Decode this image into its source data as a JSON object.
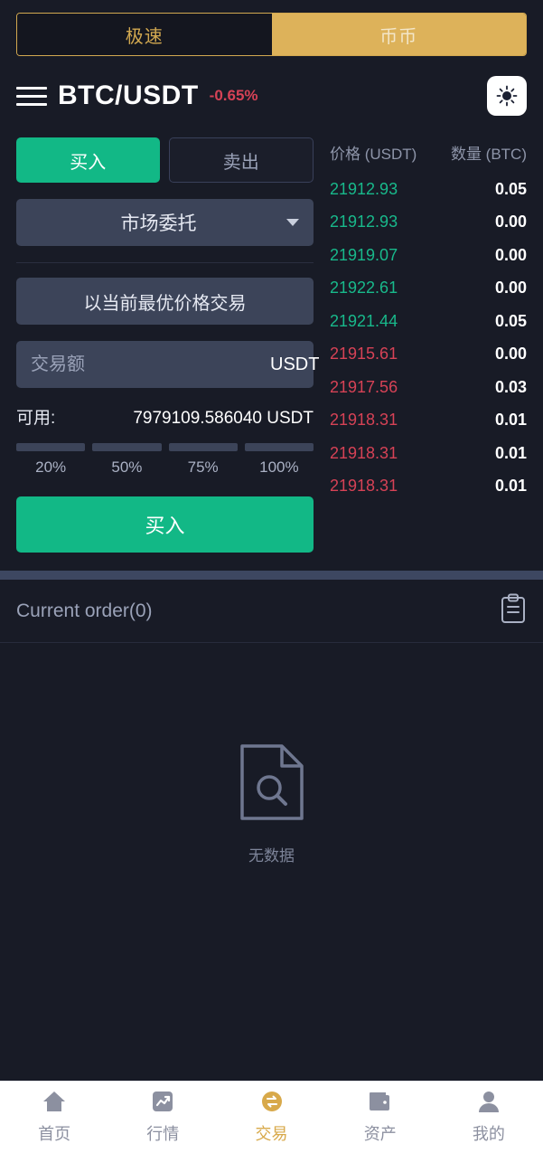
{
  "mode_tabs": [
    {
      "label": "极速",
      "active": false
    },
    {
      "label": "币币",
      "active": true
    }
  ],
  "header": {
    "menu_icon": "hamburger-icon",
    "pair": "BTC/USDT",
    "change": "-0.65%",
    "theme_icon": "sun-icon"
  },
  "trade": {
    "side_tabs": [
      {
        "label": "买入",
        "active": true
      },
      {
        "label": "卖出",
        "active": false
      }
    ],
    "order_type": "市场委托",
    "best_price_note": "以当前最优价格交易",
    "amount_placeholder": "交易额",
    "amount_value": "",
    "amount_unit": "USDT",
    "available_label": "可用:",
    "available_value": "7979109.586040 USDT",
    "percents": [
      "20%",
      "50%",
      "75%",
      "100%"
    ],
    "submit_label": "买入"
  },
  "orderbook": {
    "col_price": "价格 (USDT)",
    "col_amount": "数量 (BTC)",
    "rows": [
      {
        "price": "21912.93",
        "amount": "0.05",
        "side": "buy"
      },
      {
        "price": "21912.93",
        "amount": "0.00",
        "side": "buy"
      },
      {
        "price": "21919.07",
        "amount": "0.00",
        "side": "buy"
      },
      {
        "price": "21922.61",
        "amount": "0.00",
        "side": "buy"
      },
      {
        "price": "21921.44",
        "amount": "0.05",
        "side": "buy"
      },
      {
        "price": "21915.61",
        "amount": "0.00",
        "side": "sell"
      },
      {
        "price": "21917.56",
        "amount": "0.03",
        "side": "sell"
      },
      {
        "price": "21918.31",
        "amount": "0.01",
        "side": "sell"
      },
      {
        "price": "21918.31",
        "amount": "0.01",
        "side": "sell"
      },
      {
        "price": "21918.31",
        "amount": "0.01",
        "side": "sell"
      }
    ]
  },
  "orders": {
    "title": "Current order(0)",
    "clipboard_icon": "clipboard-icon",
    "empty_icon": "document-search-icon",
    "empty_text": "无数据"
  },
  "bottom_nav": [
    {
      "label": "首页",
      "icon": "home-icon",
      "active": false
    },
    {
      "label": "行情",
      "icon": "chart-icon",
      "active": false
    },
    {
      "label": "交易",
      "icon": "exchange-icon",
      "active": true
    },
    {
      "label": "资产",
      "icon": "wallet-icon",
      "active": false
    },
    {
      "label": "我的",
      "icon": "user-icon",
      "active": false
    }
  ],
  "colors": {
    "background": "#181b26",
    "gold": "#d2a850",
    "gold_active_bg": "#ddb25a",
    "buy_green": "#12b886",
    "sell_red": "#d64256",
    "field_bg": "#3c4459"
  }
}
